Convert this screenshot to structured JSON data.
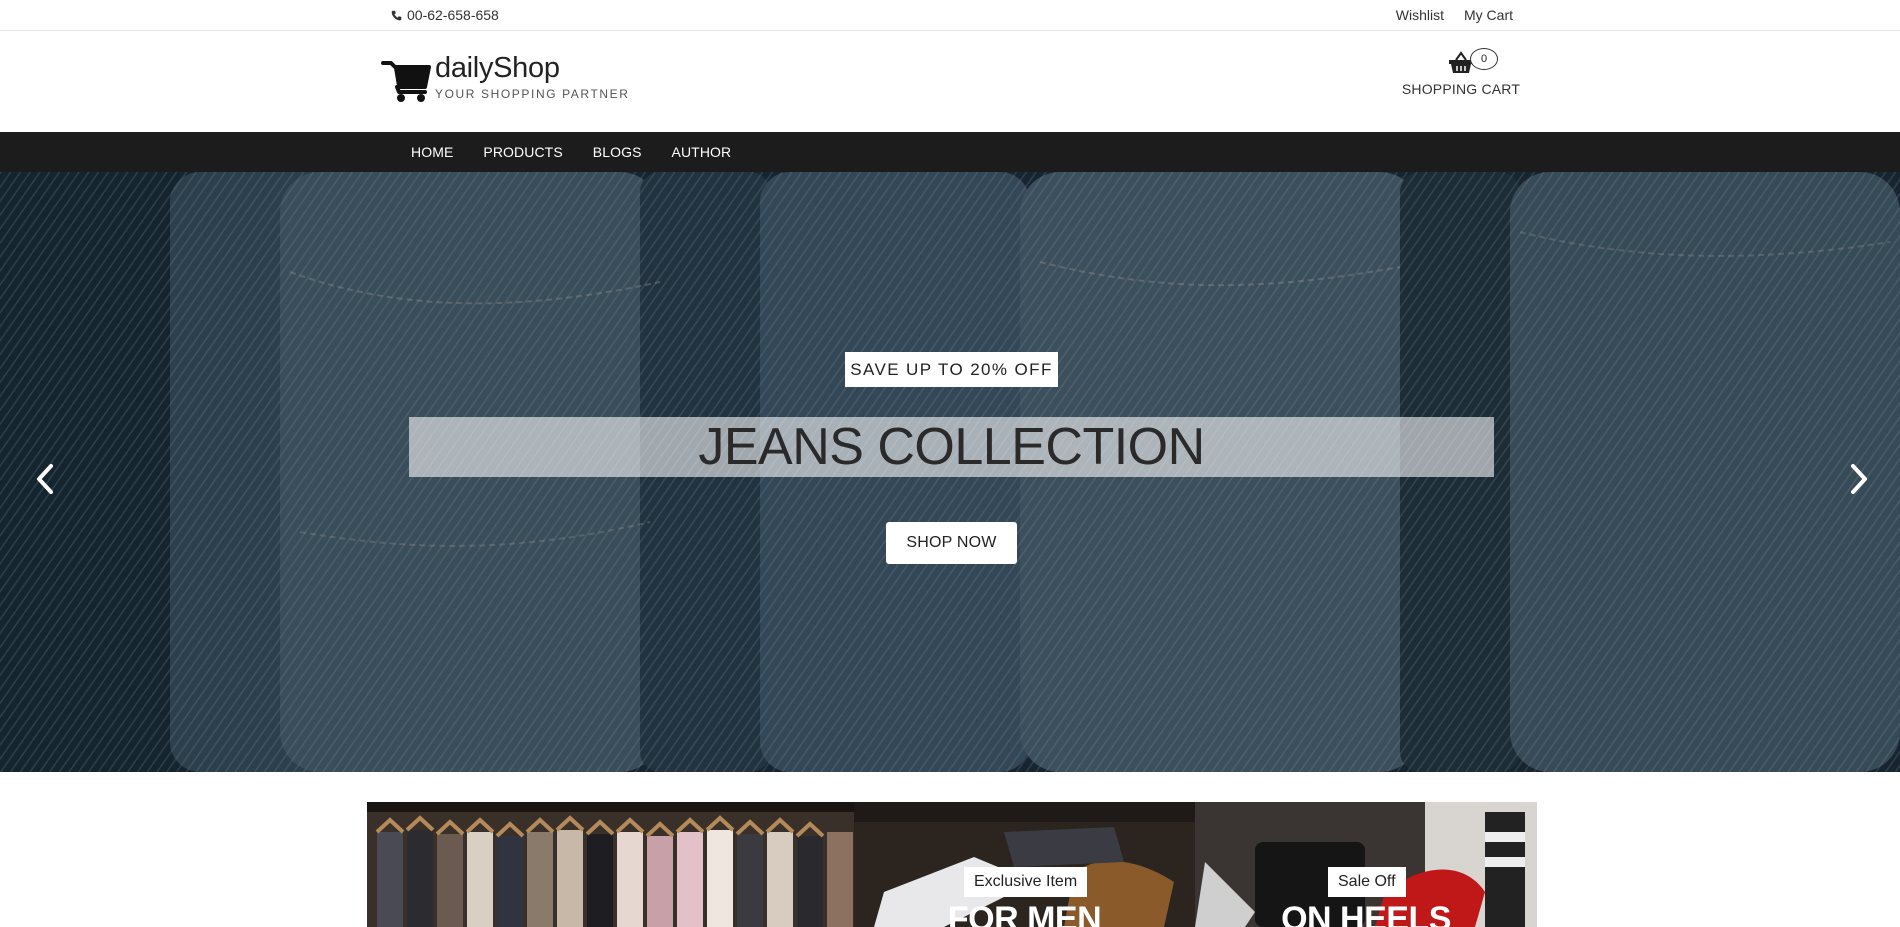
{
  "topbar": {
    "phone": "00-62-658-658",
    "links": [
      "Wishlist",
      "My Cart"
    ]
  },
  "header": {
    "brand": "dailyShop",
    "tagline": "YOUR SHOPPING PARTNER",
    "cart": {
      "count": "0",
      "label": "SHOPPING CART"
    }
  },
  "nav": {
    "items": [
      "HOME",
      "PRODUCTS",
      "BLOGS",
      "AUTHOR"
    ]
  },
  "hero": {
    "badge": "SAVE UP TO 20% OFF",
    "title": "JEANS COLLECTION",
    "button": "SHOP NOW"
  },
  "promos": [
    {
      "tag": "",
      "heading": ""
    },
    {
      "tag": "Exclusive Item",
      "heading": "FOR MEN"
    },
    {
      "tag": "Sale Off",
      "heading": "ON HEELS"
    }
  ],
  "colors": {
    "nav_bg": "#1c1c1c",
    "hero_tint": "#1e2c36",
    "text": "#333333"
  },
  "icons": [
    "phone-icon",
    "shopping-cart-logo-icon",
    "basket-icon",
    "chevron-left-icon",
    "chevron-right-icon"
  ]
}
